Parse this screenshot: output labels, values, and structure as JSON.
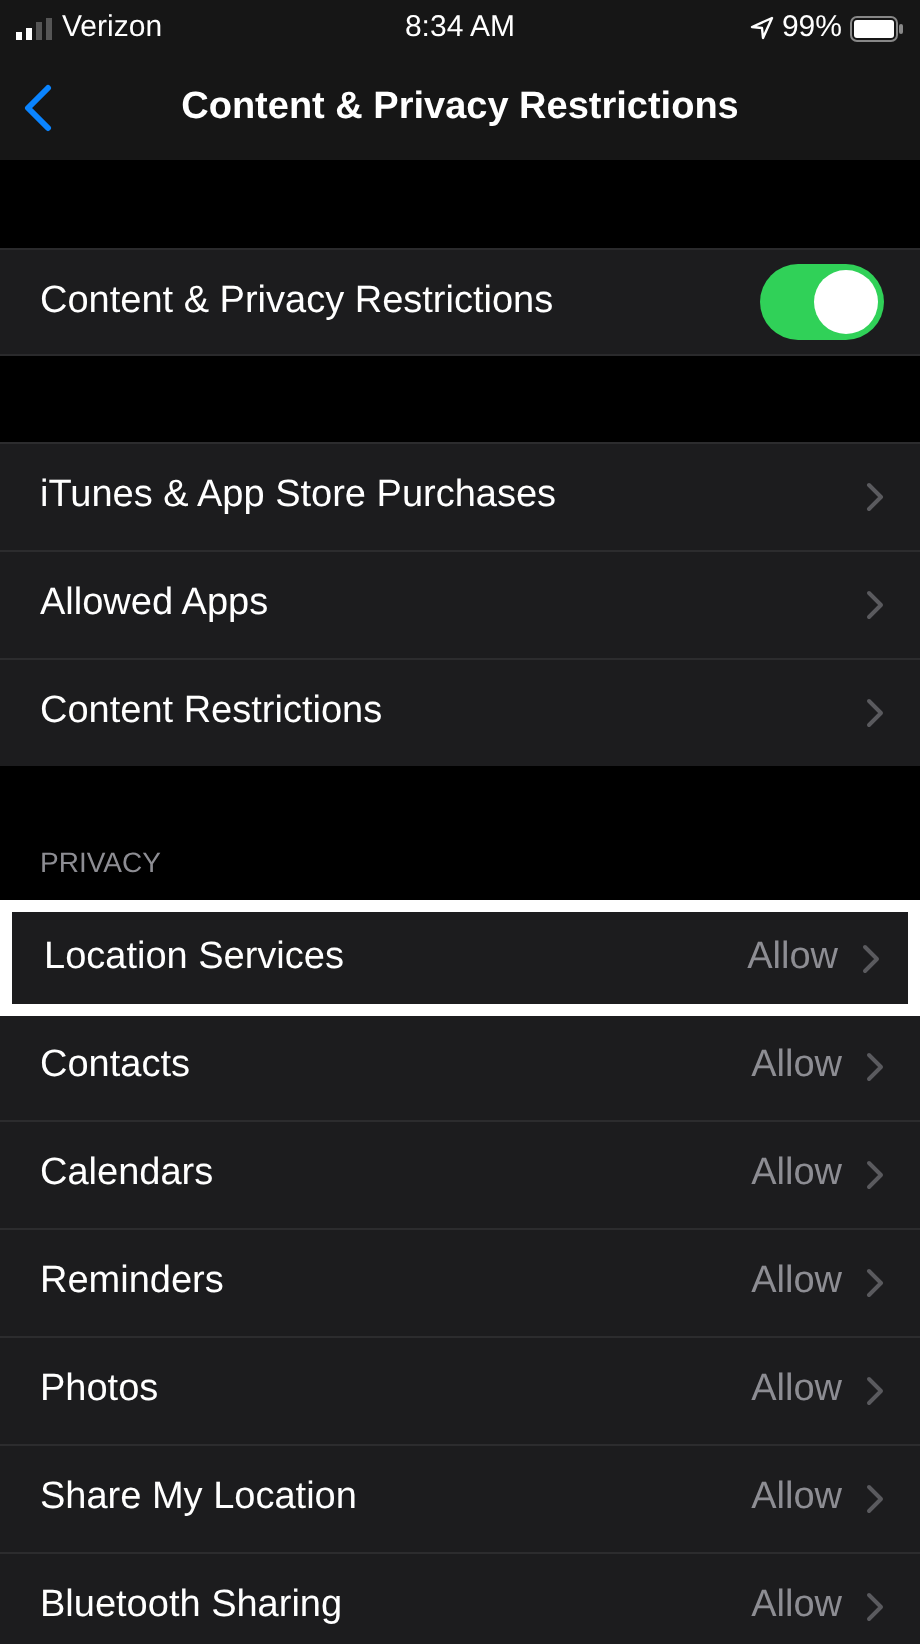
{
  "status_bar": {
    "carrier": "Verizon",
    "time": "8:34 AM",
    "battery": "99%"
  },
  "nav": {
    "title": "Content & Privacy Restrictions"
  },
  "master": {
    "label": "Content & Privacy Restrictions",
    "on": true
  },
  "groups": [
    {
      "rows": [
        {
          "label": "iTunes & App Store Purchases",
          "highlighted": false
        },
        {
          "label": "Allowed Apps",
          "highlighted": false
        },
        {
          "label": "Content Restrictions",
          "highlighted": false
        }
      ]
    },
    {
      "header": "PRIVACY",
      "rows": [
        {
          "label": "Location Services",
          "value": "Allow",
          "highlighted": true
        },
        {
          "label": "Contacts",
          "value": "Allow",
          "highlighted": false
        },
        {
          "label": "Calendars",
          "value": "Allow",
          "highlighted": false
        },
        {
          "label": "Reminders",
          "value": "Allow",
          "highlighted": false
        },
        {
          "label": "Photos",
          "value": "Allow",
          "highlighted": false
        },
        {
          "label": "Share My Location",
          "value": "Allow",
          "highlighted": false
        },
        {
          "label": "Bluetooth Sharing",
          "value": "Allow",
          "highlighted": false
        }
      ]
    }
  ]
}
